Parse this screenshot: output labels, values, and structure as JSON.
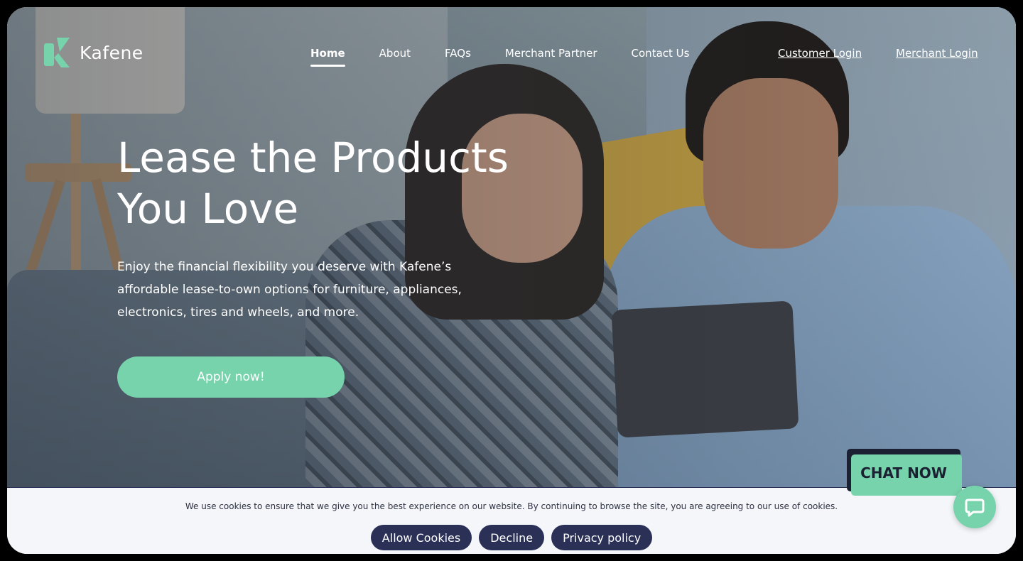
{
  "brand": {
    "name": "Kafene",
    "accent_color": "#77d3ab",
    "dark_color": "#2a3056"
  },
  "nav": {
    "items": [
      {
        "label": "Home",
        "active": true
      },
      {
        "label": "About"
      },
      {
        "label": "FAQs"
      },
      {
        "label": "Merchant Partner"
      },
      {
        "label": "Contact Us"
      }
    ],
    "customer_login": "Customer Login",
    "merchant_login": "Merchant Login"
  },
  "hero": {
    "headline_line1": "Lease the Products",
    "headline_line2": "You Love",
    "subtext": "Enjoy the financial flexibility you deserve with Kafene’s affordable lease-to-own options for furniture, appliances, electronics, tires and wheels, and more.",
    "cta_label": "Apply now!"
  },
  "cookies": {
    "message": "We use cookies to ensure that we give you the best experience on our website. By continuing to browse the site, you are agreeing to our use of cookies.",
    "allow_label": "Allow Cookies",
    "decline_label": "Decline",
    "privacy_label": "Privacy policy"
  },
  "chat": {
    "bubble_label": "CHAT NOW",
    "icon": "chat-icon"
  }
}
